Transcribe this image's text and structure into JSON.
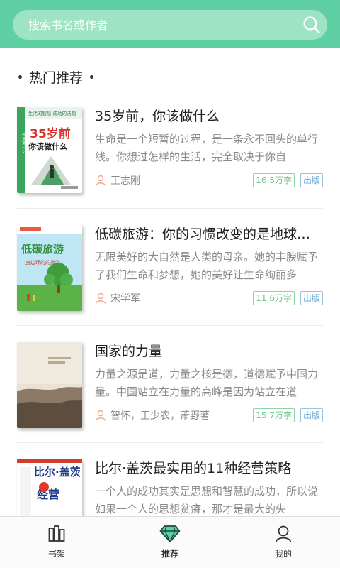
{
  "colors": {
    "accent": "#5fcfa6",
    "search_bg": "#9ee3c4",
    "tag_words": "#6fc58e",
    "tag_pub": "#6aa9d6",
    "author_icon": "#f0a88c"
  },
  "search": {
    "placeholder": "搜索书名或作者",
    "icon": "search-icon"
  },
  "section": {
    "title": "热门推荐"
  },
  "books": [
    {
      "title": "35岁前，你该做什么",
      "desc": "生命是一个短暂的过程，是一条永不回头的单行线。你想过怎样的生活，完全取决于你自",
      "author": "王志刚",
      "words": "16.5万字",
      "badge": "出版",
      "cover": {
        "top_text": "生活的智慧 成功的法则",
        "main_line1": "35岁前",
        "main_line2": "你该做什么",
        "side_text": "你该做什么"
      }
    },
    {
      "title": "低碳旅游：你的习惯改变的是地球的...",
      "desc": "无限美好的大自然是人类的母亲。她的丰腴赋予了我们生命和梦想，她的美好让生命绚丽多",
      "author": "宋学军",
      "words": "11.6万字",
      "badge": "出版",
      "cover": {
        "main_line1": "低碳旅游",
        "main_line2": "身边环的的旅游"
      }
    },
    {
      "title": "国家的力量",
      "desc": "力量之源是道，力量之核是德，道德赋予中国力量。中国站立在力量的高峰是因为站立在道",
      "author": "智怀，王少农，萧野著",
      "words": "15.7万字",
      "badge": "出版",
      "cover": {}
    },
    {
      "title": "比尔·盖茨最实用的11种经营策略",
      "desc": "一个人的成功其实是思想和智慧的成功，所以说如果一个人的思想贫瘠，那才是最大的失",
      "author": "",
      "words": "",
      "badge": "",
      "cover": {
        "main_line1": "比尔·盖茨",
        "main_line2": "经营"
      }
    }
  ],
  "tabs": [
    {
      "label": "书架",
      "icon": "bookshelf-icon"
    },
    {
      "label": "推荐",
      "icon": "diamond-icon",
      "active": true
    },
    {
      "label": "我的",
      "icon": "user-icon"
    }
  ]
}
